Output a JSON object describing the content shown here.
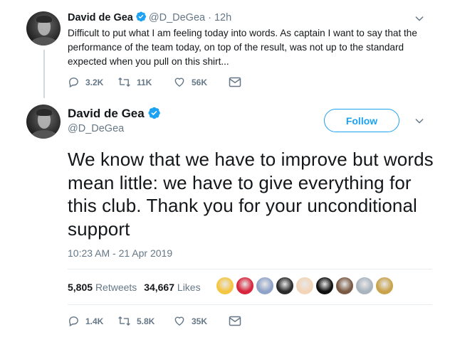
{
  "tweet1": {
    "name": "David de Gea",
    "handle": "@D_DeGea",
    "separator": "·",
    "time": "12h",
    "text": "Difficult to put what I am feeling today into words. As captain I want to say that the performance of the team today, on top of the result, was not up to the standard expected when you pull on this shirt...",
    "actions": {
      "replies": "3.2K",
      "retweets": "11K",
      "likes": "56K"
    }
  },
  "tweet2": {
    "name": "David de Gea",
    "handle": "@D_DeGea",
    "follow_label": "Follow",
    "text": "We know that we have to improve but words mean little: we have to give everything for this club. Thank you for your unconditional support",
    "timestamp": "10:23 AM - 21 Apr 2019",
    "stats": {
      "retweets_count": "5,805",
      "retweets_label": "Retweets",
      "likes_count": "34,667",
      "likes_label": "Likes"
    },
    "liker_avatar_colors": [
      "#f4c542",
      "#d7263d",
      "#8fa3c9",
      "#2b2b2b",
      "#f2d5b8",
      "#111111",
      "#7a5a44",
      "#a9b4bf",
      "#c9a34b"
    ],
    "actions": {
      "replies": "1.4K",
      "retweets": "5.8K",
      "likes": "35K"
    }
  },
  "colors": {
    "brand": "#1da1f2",
    "text": "#14171a",
    "secondary": "#657786"
  },
  "icons": [
    "verified-badge-icon",
    "chevron-down-icon",
    "reply-icon",
    "retweet-icon",
    "heart-icon",
    "direct-message-icon"
  ]
}
